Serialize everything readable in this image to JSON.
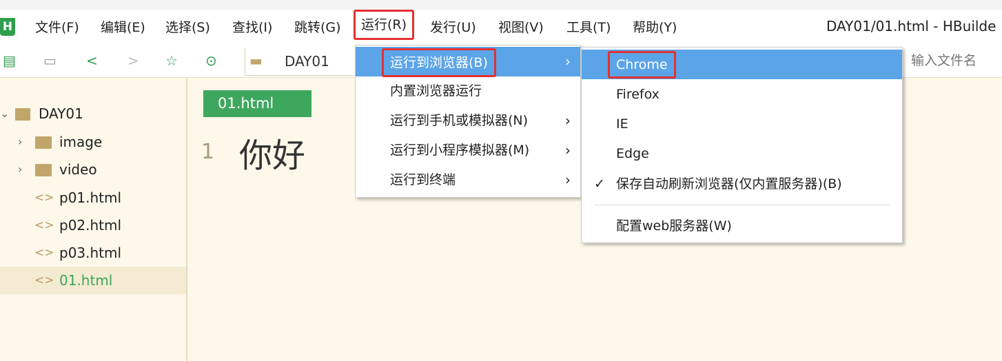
{
  "menubar": {
    "items": [
      "文件(F)",
      "编辑(E)",
      "选择(S)",
      "查找(I)",
      "跳转(G)",
      "运行(R)",
      "发行(U)",
      "视图(V)",
      "工具(T)",
      "帮助(Y)"
    ],
    "active": "运行(R)"
  },
  "window": {
    "title": "DAY01/01.html - HBuilde"
  },
  "toolbar": {
    "breadcrumb": "DAY01",
    "file_search_placeholder": "输入文件名"
  },
  "sidebar": {
    "root": "DAY01",
    "items": [
      {
        "label": "image",
        "type": "folder"
      },
      {
        "label": "video",
        "type": "folder"
      },
      {
        "label": "p01.html",
        "type": "file"
      },
      {
        "label": "p02.html",
        "type": "file"
      },
      {
        "label": "p03.html",
        "type": "file"
      },
      {
        "label": "01.html",
        "type": "file",
        "selected": true
      }
    ]
  },
  "editor": {
    "tab": "01.html",
    "lines": [
      {
        "number": "1",
        "text": "你好"
      }
    ]
  },
  "run_menu": {
    "items": [
      {
        "label": "运行到浏览器(B)",
        "submenu": true,
        "highlighted": true
      },
      {
        "label": "内置浏览器运行"
      },
      {
        "label": "运行到手机或模拟器(N)",
        "submenu": true
      },
      {
        "label": "运行到小程序模拟器(M)",
        "submenu": true
      },
      {
        "label": "运行到终端",
        "submenu": true
      }
    ]
  },
  "browser_menu": {
    "items": [
      {
        "label": "Chrome",
        "highlighted": true
      },
      {
        "label": "Firefox"
      },
      {
        "label": "IE"
      },
      {
        "label": "Edge"
      },
      {
        "label": "保存自动刷新浏览器(仅内置服务器)(B)",
        "checked": true
      },
      {
        "label": "配置web服务器(W)"
      }
    ]
  },
  "colors": {
    "accent_green": "#3ea75e",
    "highlight_blue": "#5ba4e8",
    "annotation_red": "#e53030"
  }
}
